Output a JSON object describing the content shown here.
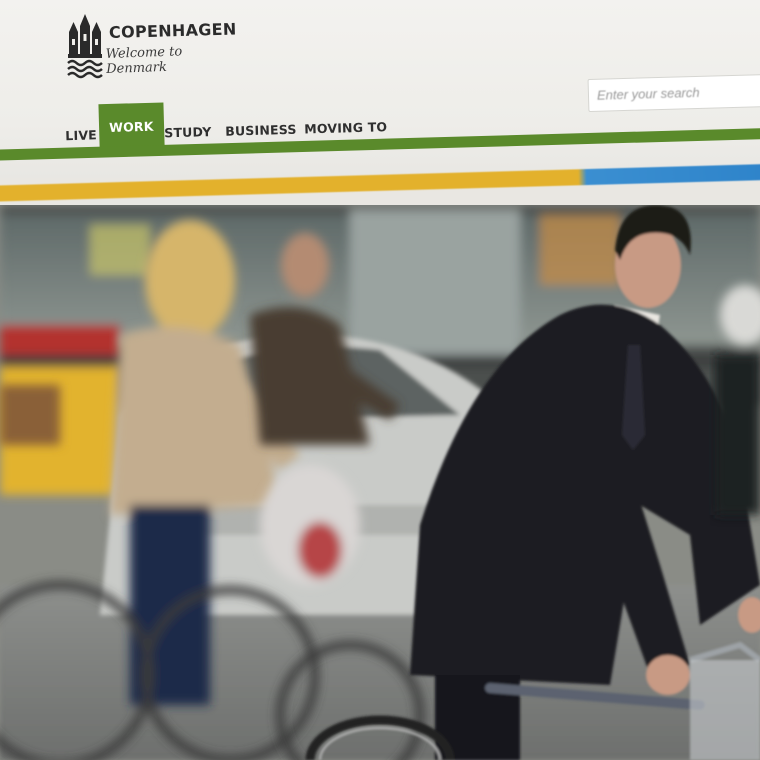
{
  "site": {
    "title": "COPENHAGEN",
    "tagline": "Welcome to Denmark",
    "logo_icon": "three-towers-crest"
  },
  "search": {
    "placeholder": "Enter your search"
  },
  "nav": {
    "items": [
      {
        "label": "LIVE",
        "active": false
      },
      {
        "label": "WORK",
        "active": true
      },
      {
        "label": "STUDY",
        "active": false
      },
      {
        "label": "BUSINESS",
        "active": false
      },
      {
        "label": "MOVING TO",
        "active": false
      }
    ]
  },
  "colors": {
    "accent_green": "#5a8a2b",
    "strip_yellow": "#e3b12c",
    "strip_blue": "#2c82c9",
    "header_bg": "#f0efeb"
  },
  "hero": {
    "description_icon": "commuters-cycling-photo"
  }
}
